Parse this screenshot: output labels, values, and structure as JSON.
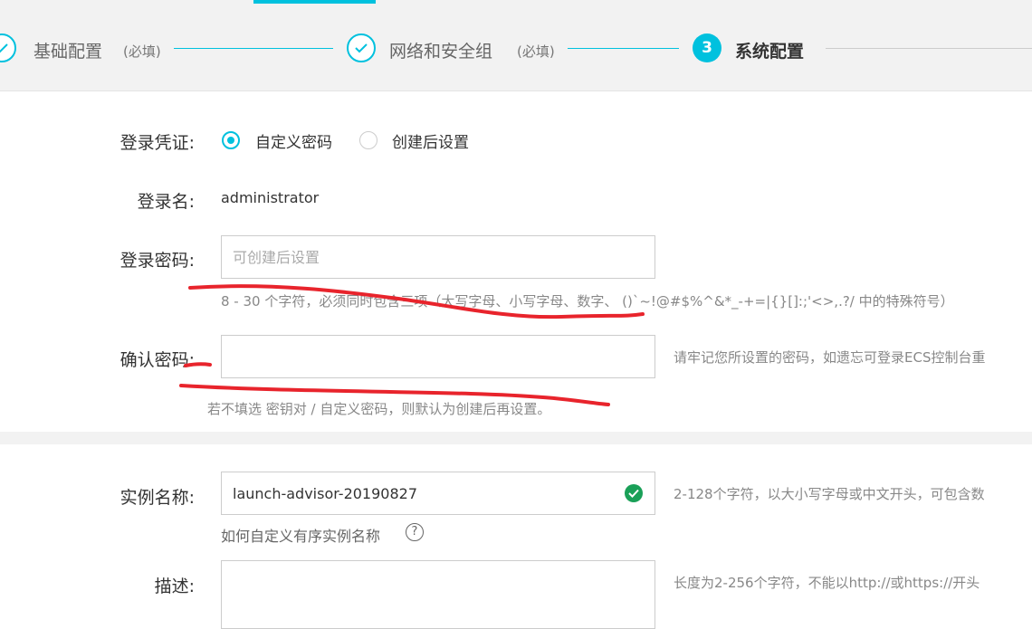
{
  "steps": [
    {
      "label": "基础配置",
      "req": "(必填)",
      "state": "done"
    },
    {
      "label": "网络和安全组",
      "req": "(必填)",
      "state": "done"
    },
    {
      "number": "3",
      "label": "系统配置",
      "state": "active"
    }
  ],
  "login": {
    "credential_label": "登录凭证:",
    "options": [
      {
        "label": "自定义密码",
        "checked": true
      },
      {
        "label": "创建后设置",
        "checked": false
      }
    ],
    "username_label": "登录名:",
    "username_value": "administrator",
    "password_label": "登录密码:",
    "password_placeholder": "可创建后设置",
    "password_hint": "8 - 30 个字符，必须同时包含三项（大写字母、小写字母、数字、 ()`~!@#$%^&*_-+=|{}[]:;'<>,.?/ 中的特殊符号）",
    "confirm_label": "确认密码:",
    "confirm_hint": "请牢记您所设置的密码，如遗忘可登录ECS控制台重",
    "note": "若不填选 密钥对 / 自定义密码，则默认为创建后再设置。"
  },
  "instance": {
    "name_label": "实例名称:",
    "name_value": "launch-advisor-20190827",
    "name_hint": "2-128个字符，以大小写字母或中文开头，可包含数",
    "name_help": "如何自定义有序实例名称",
    "desc_label": "描述:",
    "desc_hint": "长度为2-256个字符，不能以http://或https://开头"
  },
  "colors": {
    "accent": "#00c1de",
    "valid": "#1aa058",
    "annotation": "#e8242c"
  }
}
